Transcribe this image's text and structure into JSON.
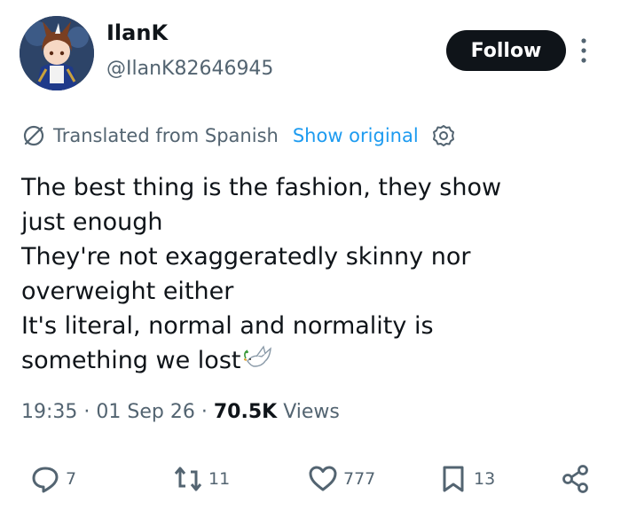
{
  "user": {
    "display_name": "IlanK",
    "handle": "@IlanK82646945",
    "follow_label": "Follow"
  },
  "translation": {
    "notice": "Translated from Spanish",
    "show_original": "Show original"
  },
  "tweet": {
    "lines": [
      "The best thing is the fashion, they show",
      "just enough",
      "They're not exaggeratedly skinny nor",
      "overweight either",
      "It's literal, normal and normality is",
      "something we lost"
    ],
    "time": "19:35",
    "date": "01 Sep 26",
    "views_count": "70.5K",
    "views_label": "Views"
  },
  "actions": {
    "replies": "7",
    "reposts": "11",
    "likes": "777",
    "bookmarks": "13"
  },
  "icons": [
    "avatar",
    "more-icon",
    "translate-icon",
    "gear-icon",
    "dove-emoji",
    "reply-icon",
    "repost-icon",
    "like-icon",
    "bookmark-icon",
    "share-icon"
  ],
  "colors": {
    "text": "#0f1419",
    "secondary": "#536471",
    "link": "#1d9bf0",
    "button_bg": "#0f1419"
  }
}
